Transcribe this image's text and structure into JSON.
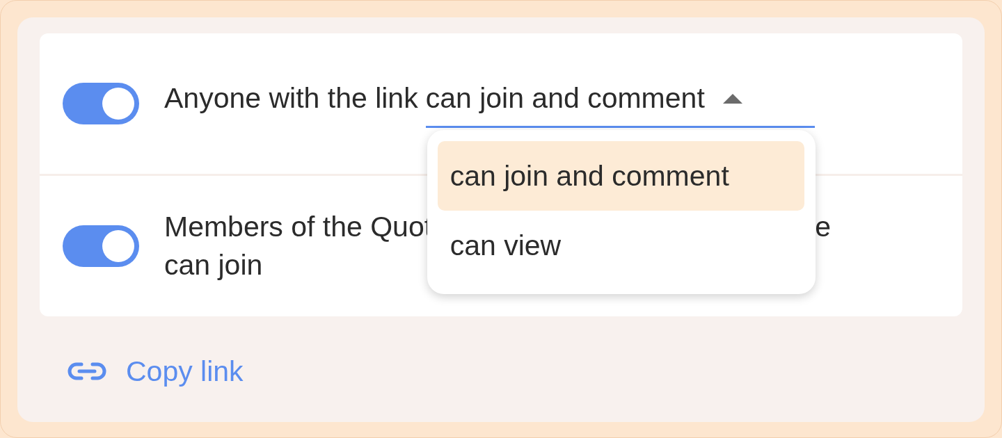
{
  "settings": [
    {
      "kind": "select",
      "on": true,
      "label": "Anyone with the link",
      "value": "can join and comment",
      "expanded": true,
      "options": [
        {
          "label": "can join and comment",
          "selected": true
        },
        {
          "label": "can view",
          "selected": false
        }
      ]
    },
    {
      "kind": "text",
      "on": true,
      "lines": [
        [
          "Members of the Quot",
          "e"
        ],
        [
          "can join"
        ]
      ]
    }
  ],
  "copy_link": {
    "label": "Copy link"
  }
}
